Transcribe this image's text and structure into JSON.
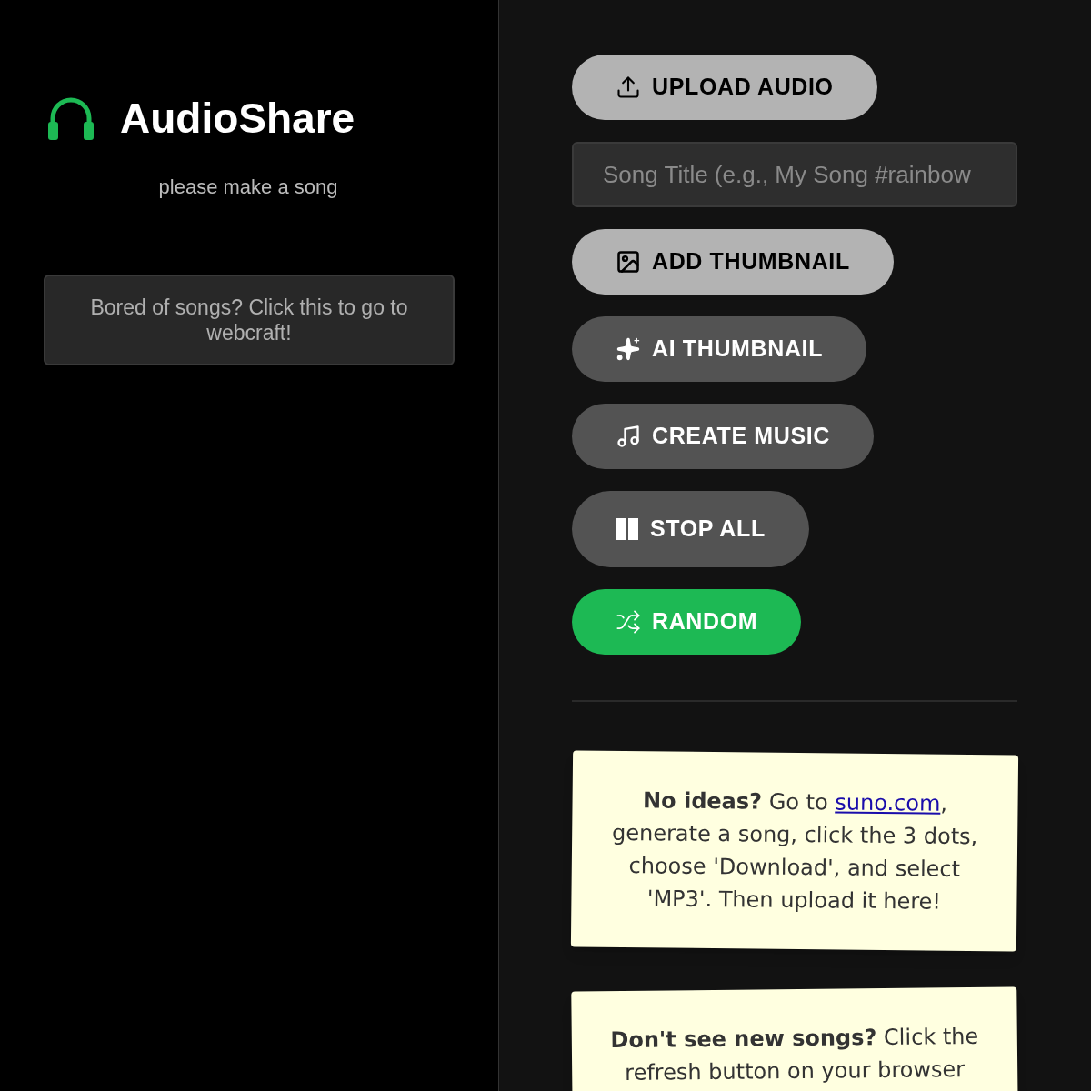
{
  "sidebar": {
    "app_name": "AudioShare",
    "tagline": "please make a song",
    "link_button": "Bored of songs? Click this to go to webcraft!"
  },
  "controls": [
    {
      "kind": "button",
      "label": "UPLOAD AUDIO"
    },
    {
      "kind": "field",
      "placeholder": "Song Title (e.g., My Song #rainbow"
    },
    {
      "kind": "button",
      "label": "ADD THUMBNAIL"
    },
    {
      "kind": "button",
      "label": "AI THUMBNAIL"
    },
    {
      "kind": "button",
      "label": "CREATE MUSIC"
    },
    {
      "kind": "button",
      "label": "STOP ALL"
    },
    {
      "kind": "button",
      "label": "RANDOM"
    }
  ],
  "notes": [
    {
      "lead": "No ideas?",
      "before": " Go to ",
      "link": "suno.com",
      "after": ", generate a song, click the 3 dots, choose 'Download', and select 'MP3'. Then upload it here!"
    },
    {
      "lead": "Don't see new songs?",
      "before": " Click the refresh button on your browser"
    }
  ]
}
